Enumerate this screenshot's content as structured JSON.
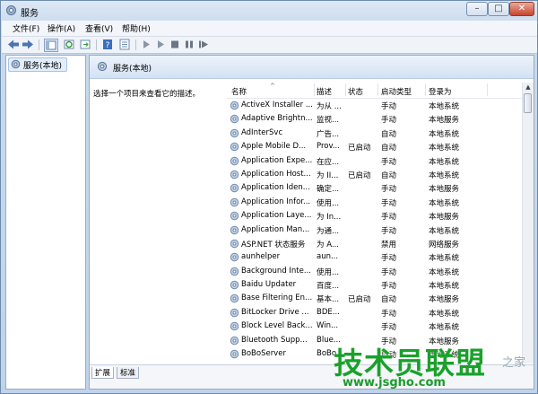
{
  "window": {
    "title": "服务"
  },
  "menu": [
    "文件(F)",
    "操作(A)",
    "查看(V)",
    "帮助(H)"
  ],
  "toolbar": [
    "back-arrow-icon",
    "forward-arrow-icon",
    "show-hide-console-tree-icon",
    "refresh-icon",
    "export-list-icon",
    "help-icon",
    "properties-icon",
    "start-service-icon",
    "start-service-alt-icon",
    "stop-service-icon",
    "pause-service-icon",
    "restart-service-icon"
  ],
  "tree": {
    "root": "服务(本地)"
  },
  "header": {
    "title": "服务(本地)"
  },
  "description_prompt": "选择一个项目来查看它的描述。",
  "columns": {
    "name": "名称",
    "description": "描述",
    "status": "状态",
    "startup": "启动类型",
    "logon": "登录为"
  },
  "services": [
    {
      "name": "ActiveX Installer ...",
      "desc": "为从 ...",
      "status": "",
      "startup": "手动",
      "logon": "本地系统"
    },
    {
      "name": "Adaptive Brightn...",
      "desc": "监视...",
      "status": "",
      "startup": "手动",
      "logon": "本地服务"
    },
    {
      "name": "AdInterSvc",
      "desc": "广告...",
      "status": "",
      "startup": "自动",
      "logon": "本地系统"
    },
    {
      "name": "Apple Mobile D...",
      "desc": "Prov...",
      "status": "已启动",
      "startup": "自动",
      "logon": "本地系统"
    },
    {
      "name": "Application Expe...",
      "desc": "在应...",
      "status": "",
      "startup": "手动",
      "logon": "本地系统"
    },
    {
      "name": "Application Host...",
      "desc": "为 II...",
      "status": "已启动",
      "startup": "自动",
      "logon": "本地系统"
    },
    {
      "name": "Application Iden...",
      "desc": "确定...",
      "status": "",
      "startup": "手动",
      "logon": "本地服务"
    },
    {
      "name": "Application Infor...",
      "desc": "使用...",
      "status": "",
      "startup": "手动",
      "logon": "本地系统"
    },
    {
      "name": "Application Laye...",
      "desc": "为 In...",
      "status": "",
      "startup": "手动",
      "logon": "本地服务"
    },
    {
      "name": "Application Man...",
      "desc": "为通...",
      "status": "",
      "startup": "手动",
      "logon": "本地系统"
    },
    {
      "name": "ASP.NET 状态服务",
      "desc": "为 A...",
      "status": "",
      "startup": "禁用",
      "logon": "网络服务"
    },
    {
      "name": "aunhelper",
      "desc": "aun...",
      "status": "",
      "startup": "手动",
      "logon": "本地系统"
    },
    {
      "name": "Background Inte...",
      "desc": "使用...",
      "status": "",
      "startup": "手动",
      "logon": "本地系统"
    },
    {
      "name": "Baidu Updater",
      "desc": "百度...",
      "status": "",
      "startup": "手动",
      "logon": "本地系统"
    },
    {
      "name": "Base Filtering En...",
      "desc": "基本...",
      "status": "已启动",
      "startup": "自动",
      "logon": "本地服务"
    },
    {
      "name": "BitLocker Drive ...",
      "desc": "BDE...",
      "status": "",
      "startup": "手动",
      "logon": "本地系统"
    },
    {
      "name": "Block Level Back...",
      "desc": "Win...",
      "status": "",
      "startup": "手动",
      "logon": "本地系统"
    },
    {
      "name": "Bluetooth Supp...",
      "desc": "Blue...",
      "status": "",
      "startup": "手动",
      "logon": "本地服务"
    },
    {
      "name": "BoBoServer",
      "desc": "BoBo...",
      "status": "",
      "startup": "自动",
      "logon": "本地系统"
    }
  ],
  "tabs": [
    "扩展",
    "标准"
  ],
  "watermark": {
    "text": "技术员联盟",
    "url": "www.jsgho.com",
    "corner": "之家"
  },
  "colors": {
    "watermark": "#1aa12b",
    "selection": "#e3eefa"
  }
}
